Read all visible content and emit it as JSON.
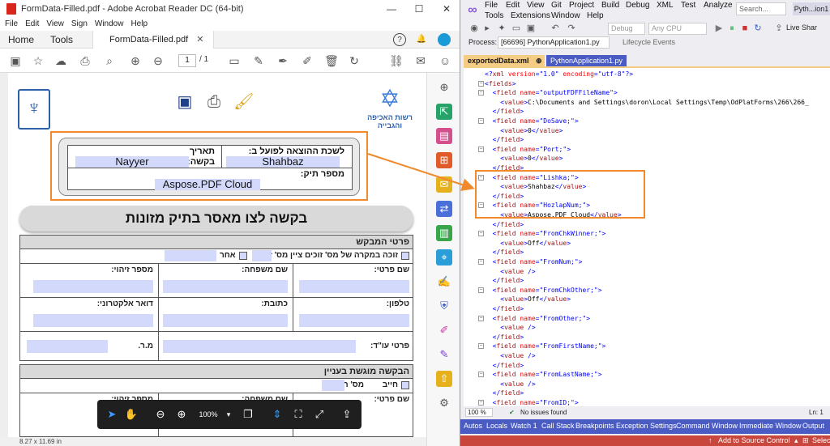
{
  "acrobat": {
    "title": "FormData-Filled.pdf - Adobe Acrobat Reader DC (64-bit)",
    "menu": [
      "File",
      "Edit",
      "View",
      "Sign",
      "Window",
      "Help"
    ],
    "tabs": {
      "home": "Home",
      "tools": "Tools",
      "doc": "FormData-Filled.pdf"
    },
    "page_current": "1",
    "page_total": "/ 1",
    "page_size": "8.27 x 11.69 in",
    "zoom": "100%",
    "form": {
      "label_lishka": "לשכת ההוצאה לפועל ב:",
      "value_lishka": "Shahbaz",
      "label_date": "תאריך",
      "label_request": "בקשה:",
      "value_request": "Nayyer",
      "label_file_no": "מספר תיק:",
      "value_file_no": "Aspose.PDF Cloud",
      "big_title": "בקשה לצו מאסר בתיק מזונות",
      "section1": "פרטי המבקש",
      "row_winner": "זוכה במקרה של מס' זוכים ציין מס' זוכה",
      "row_other": "אחר",
      "lbl_first_name": "שם פרטי:",
      "lbl_last_name": "שם משפחה:",
      "lbl_id": "מספר זיהוי:",
      "lbl_phone": "טלפון:",
      "lbl_address": "כתובת:",
      "lbl_email": "דואר אלקטרוני:",
      "lbl_lawyer": "פרטי עו\"ד:",
      "lbl_mr": "מ.ר.",
      "section2": "הבקשה מוגשת בעניין",
      "lbl_debtor": "חייב",
      "lbl_debtor_no": "מס' חייב:",
      "lbl_first_name2": "שם פרטי:",
      "lbl_last_name2": "שם משפחה:",
      "lbl_id2": "מספר זיהוי:"
    }
  },
  "vs": {
    "menu_row1": [
      "File",
      "Edit",
      "View",
      "Git",
      "Project",
      "Build",
      "Debug",
      "XML",
      "Test",
      "Analyze"
    ],
    "menu_row2": [
      "Tools",
      "Extensions",
      "Window",
      "Help"
    ],
    "search_placeholder": "Search...",
    "solution_name": "Pyth...ion1",
    "config": "Debug",
    "platform": "Any CPU",
    "live_share": "Live Shar",
    "process_label": "Process:",
    "process_value": "[66696] PythonApplication1.py",
    "lifecycle": "Lifecycle Events",
    "tab_active": "exportedData.xml",
    "tab_inactive": "PythonApplication1.py",
    "zoom": "100 %",
    "issues": "No issues found",
    "line_info": "Ln: 1",
    "bottom_tabs": [
      "Autos",
      "Locals",
      "Watch 1",
      "Call Stack",
      "Breakpoints",
      "Exception Settings",
      "Command Window",
      "Immediate Window",
      "Output"
    ],
    "status_source": "Add to Source Control",
    "status_select": "Selec",
    "code": [
      [
        [
          "br",
          "<?"
        ],
        [
          "tag",
          "xml"
        ],
        [
          "attr",
          " version"
        ],
        [
          "br",
          "="
        ],
        [
          "val",
          "\"1.0\""
        ],
        [
          "attr",
          " encoding"
        ],
        [
          "br",
          "="
        ],
        [
          "val",
          "\"utf-8\""
        ],
        [
          "br",
          "?>"
        ]
      ],
      [
        [
          "br",
          "<"
        ],
        [
          "tag",
          "fields"
        ],
        [
          "br",
          ">"
        ]
      ],
      [
        [
          "br",
          "  <"
        ],
        [
          "tag",
          "field"
        ],
        [
          "attr",
          " name"
        ],
        [
          "br",
          "="
        ],
        [
          "val",
          "\"outputFDFFileName\""
        ],
        [
          "br",
          ">"
        ]
      ],
      [
        [
          "br",
          "    <"
        ],
        [
          "tag",
          "value"
        ],
        [
          "br",
          ">"
        ],
        [
          "txt",
          "C:\\Documents and Settings\\doron\\Local Settings\\Temp\\OdPlatForms\\266\\266_"
        ]
      ],
      [
        [
          "br",
          "  </"
        ],
        [
          "tag",
          "field"
        ],
        [
          "br",
          ">"
        ]
      ],
      [
        [
          "br",
          "  <"
        ],
        [
          "tag",
          "field"
        ],
        [
          "attr",
          " name"
        ],
        [
          "br",
          "="
        ],
        [
          "val",
          "\"DoSave;\""
        ],
        [
          "br",
          ">"
        ]
      ],
      [
        [
          "br",
          "    <"
        ],
        [
          "tag",
          "value"
        ],
        [
          "br",
          ">"
        ],
        [
          "txt",
          "0"
        ],
        [
          "br",
          "</"
        ],
        [
          "tag",
          "value"
        ],
        [
          "br",
          ">"
        ]
      ],
      [
        [
          "br",
          "  </"
        ],
        [
          "tag",
          "field"
        ],
        [
          "br",
          ">"
        ]
      ],
      [
        [
          "br",
          "  <"
        ],
        [
          "tag",
          "field"
        ],
        [
          "attr",
          " name"
        ],
        [
          "br",
          "="
        ],
        [
          "val",
          "\"Port;\""
        ],
        [
          "br",
          ">"
        ]
      ],
      [
        [
          "br",
          "    <"
        ],
        [
          "tag",
          "value"
        ],
        [
          "br",
          ">"
        ],
        [
          "txt",
          "0"
        ],
        [
          "br",
          "</"
        ],
        [
          "tag",
          "value"
        ],
        [
          "br",
          ">"
        ]
      ],
      [
        [
          "br",
          "  </"
        ],
        [
          "tag",
          "field"
        ],
        [
          "br",
          ">"
        ]
      ],
      [
        [
          "br",
          "  <"
        ],
        [
          "tag",
          "field"
        ],
        [
          "attr",
          " name"
        ],
        [
          "br",
          "="
        ],
        [
          "val",
          "\"Lishka;\""
        ],
        [
          "br",
          ">"
        ]
      ],
      [
        [
          "br",
          "    <"
        ],
        [
          "tag",
          "value"
        ],
        [
          "br",
          ">"
        ],
        [
          "txt",
          "Shahbaz"
        ],
        [
          "br",
          "</"
        ],
        [
          "tag",
          "value"
        ],
        [
          "br",
          ">"
        ]
      ],
      [
        [
          "br",
          "  </"
        ],
        [
          "tag",
          "field"
        ],
        [
          "br",
          ">"
        ]
      ],
      [
        [
          "br",
          "  <"
        ],
        [
          "tag",
          "field"
        ],
        [
          "attr",
          " name"
        ],
        [
          "br",
          "="
        ],
        [
          "val",
          "\"HozlapNum;\""
        ],
        [
          "br",
          ">"
        ]
      ],
      [
        [
          "br",
          "    <"
        ],
        [
          "tag",
          "value"
        ],
        [
          "br",
          ">"
        ],
        [
          "txt",
          "Aspose.PDF Cloud"
        ],
        [
          "br",
          "</"
        ],
        [
          "tag",
          "value"
        ],
        [
          "br",
          ">"
        ]
      ],
      [
        [
          "br",
          "  </"
        ],
        [
          "tag",
          "field"
        ],
        [
          "br",
          ">"
        ]
      ],
      [
        [
          "br",
          "  <"
        ],
        [
          "tag",
          "field"
        ],
        [
          "attr",
          " name"
        ],
        [
          "br",
          "="
        ],
        [
          "val",
          "\"FromChkWinner;\""
        ],
        [
          "br",
          ">"
        ]
      ],
      [
        [
          "br",
          "    <"
        ],
        [
          "tag",
          "value"
        ],
        [
          "br",
          ">"
        ],
        [
          "txt",
          "Off"
        ],
        [
          "br",
          "</"
        ],
        [
          "tag",
          "value"
        ],
        [
          "br",
          ">"
        ]
      ],
      [
        [
          "br",
          "  </"
        ],
        [
          "tag",
          "field"
        ],
        [
          "br",
          ">"
        ]
      ],
      [
        [
          "br",
          "  <"
        ],
        [
          "tag",
          "field"
        ],
        [
          "attr",
          " name"
        ],
        [
          "br",
          "="
        ],
        [
          "val",
          "\"FromNum;\""
        ],
        [
          "br",
          ">"
        ]
      ],
      [
        [
          "br",
          "    <"
        ],
        [
          "tag",
          "value"
        ],
        [
          "br",
          " />"
        ]
      ],
      [
        [
          "br",
          "  </"
        ],
        [
          "tag",
          "field"
        ],
        [
          "br",
          ">"
        ]
      ],
      [
        [
          "br",
          "  <"
        ],
        [
          "tag",
          "field"
        ],
        [
          "attr",
          " name"
        ],
        [
          "br",
          "="
        ],
        [
          "val",
          "\"FromChkOther;\""
        ],
        [
          "br",
          ">"
        ]
      ],
      [
        [
          "br",
          "    <"
        ],
        [
          "tag",
          "value"
        ],
        [
          "br",
          ">"
        ],
        [
          "txt",
          "Off"
        ],
        [
          "br",
          "</"
        ],
        [
          "tag",
          "value"
        ],
        [
          "br",
          ">"
        ]
      ],
      [
        [
          "br",
          "  </"
        ],
        [
          "tag",
          "field"
        ],
        [
          "br",
          ">"
        ]
      ],
      [
        [
          "br",
          "  <"
        ],
        [
          "tag",
          "field"
        ],
        [
          "attr",
          " name"
        ],
        [
          "br",
          "="
        ],
        [
          "val",
          "\"FromOther;\""
        ],
        [
          "br",
          ">"
        ]
      ],
      [
        [
          "br",
          "    <"
        ],
        [
          "tag",
          "value"
        ],
        [
          "br",
          " />"
        ]
      ],
      [
        [
          "br",
          "  </"
        ],
        [
          "tag",
          "field"
        ],
        [
          "br",
          ">"
        ]
      ],
      [
        [
          "br",
          "  <"
        ],
        [
          "tag",
          "field"
        ],
        [
          "attr",
          " name"
        ],
        [
          "br",
          "="
        ],
        [
          "val",
          "\"FromFirstName;\""
        ],
        [
          "br",
          ">"
        ]
      ],
      [
        [
          "br",
          "    <"
        ],
        [
          "tag",
          "value"
        ],
        [
          "br",
          " />"
        ]
      ],
      [
        [
          "br",
          "  </"
        ],
        [
          "tag",
          "field"
        ],
        [
          "br",
          ">"
        ]
      ],
      [
        [
          "br",
          "  <"
        ],
        [
          "tag",
          "field"
        ],
        [
          "attr",
          " name"
        ],
        [
          "br",
          "="
        ],
        [
          "val",
          "\"FromLastName;\""
        ],
        [
          "br",
          ">"
        ]
      ],
      [
        [
          "br",
          "    <"
        ],
        [
          "tag",
          "value"
        ],
        [
          "br",
          " />"
        ]
      ],
      [
        [
          "br",
          "  </"
        ],
        [
          "tag",
          "field"
        ],
        [
          "br",
          ">"
        ]
      ],
      [
        [
          "br",
          "  <"
        ],
        [
          "tag",
          "field"
        ],
        [
          "attr",
          " name"
        ],
        [
          "br",
          "="
        ],
        [
          "val",
          "\"FromID;\""
        ],
        [
          "br",
          ">"
        ]
      ],
      [
        [
          "br",
          "    <"
        ],
        [
          "tag",
          "value"
        ],
        [
          "br",
          " />"
        ]
      ]
    ]
  }
}
